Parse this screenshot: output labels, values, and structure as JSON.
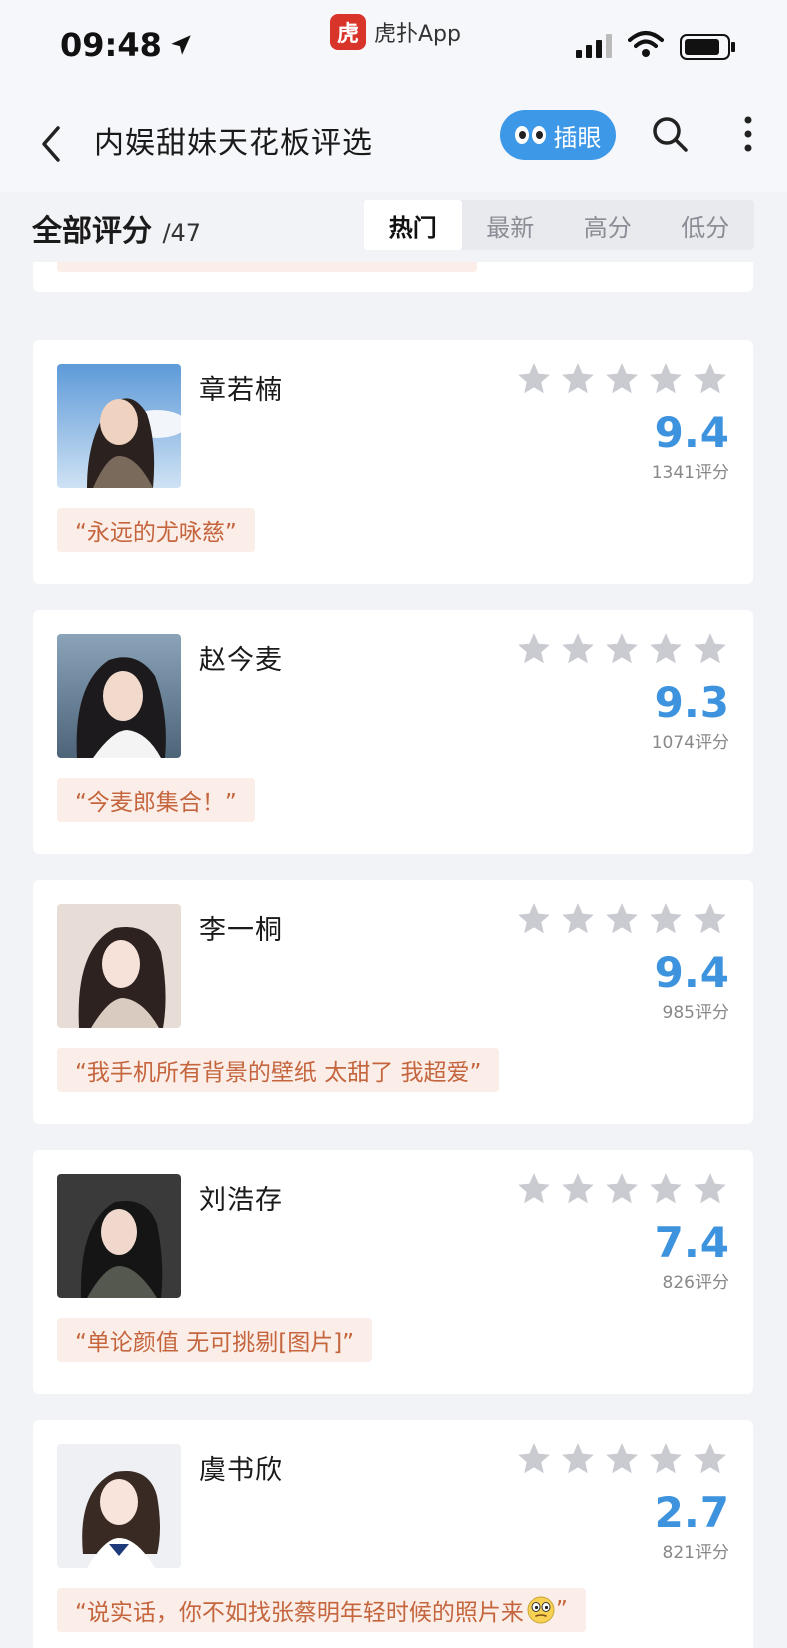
{
  "status_bar": {
    "time": "09:48",
    "app_logo_text": "虎",
    "app_name": "虎扑App"
  },
  "nav": {
    "title": "内娱甜妹天花板评选",
    "peek_label": "插眼"
  },
  "filter": {
    "all_label": "全部评分",
    "count": "/47",
    "tabs": [
      "热门",
      "最新",
      "高分",
      "低分"
    ],
    "active_tab": "热门"
  },
  "colors": {
    "accent_blue": "#3d93dd",
    "comment_bg": "#fbeee8",
    "comment_text": "#c4653e",
    "star_gray": "#c9cbd1"
  },
  "entries": [
    {
      "name": "章若楠",
      "score": "9.4",
      "count": "1341评分",
      "comment": "“永远的尤咏慈”",
      "stars_filled": 0
    },
    {
      "name": "赵今麦",
      "score": "9.3",
      "count": "1074评分",
      "comment": "“今麦郎集合！”",
      "stars_filled": 0
    },
    {
      "name": "李一桐",
      "score": "9.4",
      "count": "985评分",
      "comment": "“我手机所有背景的壁纸  太甜了  我超爱”",
      "stars_filled": 0
    },
    {
      "name": "刘浩存",
      "score": "7.4",
      "count": "826评分",
      "comment": "“单论颜值 无可挑剔[图片]”",
      "stars_filled": 0
    },
    {
      "name": "虞书欣",
      "score": "2.7",
      "count": "821评分",
      "comment": "“说实话，你不如找张蔡明年轻时候的照片来",
      "comment_end": "”",
      "stars_filled": 0
    }
  ]
}
